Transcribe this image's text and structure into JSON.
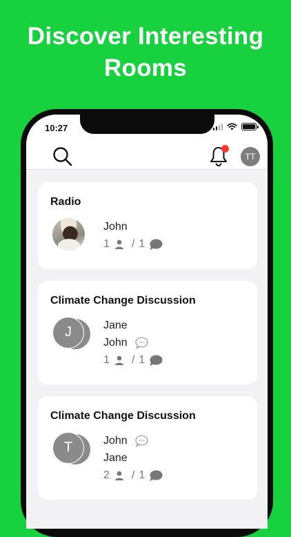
{
  "headline": {
    "line1": "Discover Interesting",
    "line2": "Rooms"
  },
  "status_bar": {
    "time": "10:27"
  },
  "topbar": {
    "profile_initials": "TT",
    "colors": {
      "notification_dot": "#ff3b30",
      "avatar_bg": "#7d7d7d"
    }
  },
  "rooms": [
    {
      "title": "Radio",
      "avatar": {
        "type": "photo"
      },
      "speakers": [
        {
          "name": "John",
          "speaking": false
        }
      ],
      "stats": {
        "listeners": "1",
        "speakers": "1"
      }
    },
    {
      "title": "Climate Change Discussion",
      "avatar": {
        "type": "initial",
        "initial": "J"
      },
      "speakers": [
        {
          "name": "Jane",
          "speaking": false
        },
        {
          "name": "John",
          "speaking": true
        }
      ],
      "stats": {
        "listeners": "1",
        "speakers": "1"
      }
    },
    {
      "title": "Climate Change Discussion",
      "avatar": {
        "type": "initial",
        "initial": "T"
      },
      "speakers": [
        {
          "name": "John",
          "speaking": true
        },
        {
          "name": "Jane",
          "speaking": false
        }
      ],
      "stats": {
        "listeners": "2",
        "speakers": "1"
      }
    }
  ],
  "colors": {
    "background": "#17d13e",
    "screen_bg": "#f2f2f4",
    "card_bg": "#ffffff",
    "muted_text": "#777777"
  }
}
